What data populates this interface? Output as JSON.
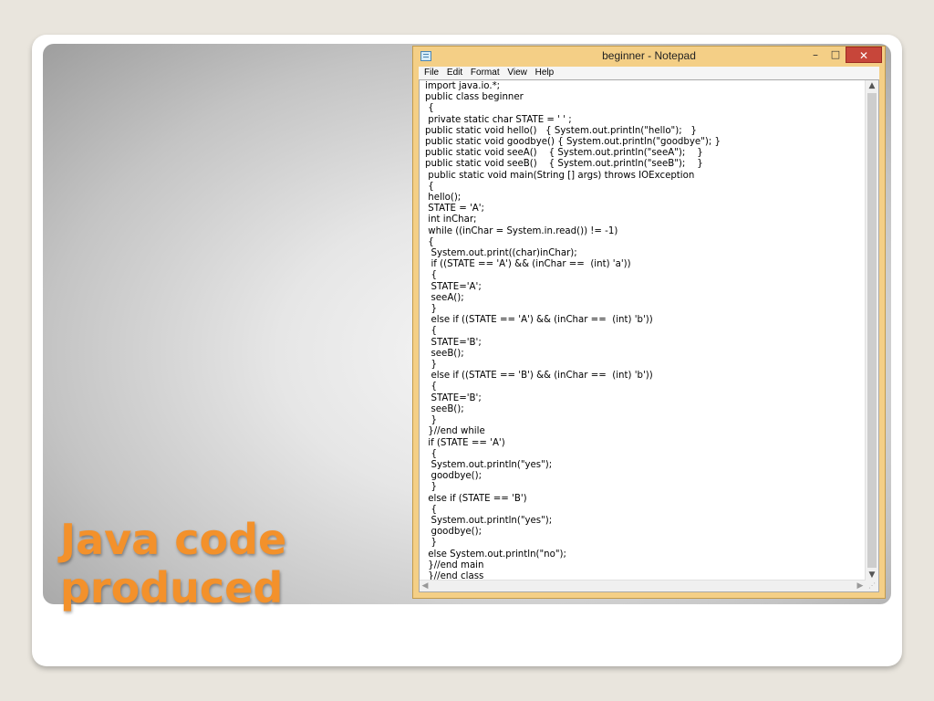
{
  "slide": {
    "title_line1": "Java code",
    "title_line2": "produced"
  },
  "window": {
    "title": "beginner - Notepad",
    "minimize": "–",
    "maximize": "□",
    "close": "✕"
  },
  "menu": {
    "file": "File",
    "edit": "Edit",
    "format": "Format",
    "view": "View",
    "help": "Help"
  },
  "editor": {
    "code": "import java.io.*;\npublic class beginner\n {\n private static char STATE = ' ' ;\npublic static void hello()   { System.out.println(\"hello\");   }\npublic static void goodbye() { System.out.println(\"goodbye\"); }\npublic static void seeA()    { System.out.println(\"seeA\");    }\npublic static void seeB()    { System.out.println(\"seeB\");    }\n public static void main(String [] args) throws IOException\n {\n hello();\n STATE = 'A';\n int inChar;\n while ((inChar = System.in.read()) != -1)\n {\n  System.out.print((char)inChar);\n  if ((STATE == 'A') && (inChar ==  (int) 'a'))\n  {\n  STATE='A';\n  seeA();\n  }\n  else if ((STATE == 'A') && (inChar ==  (int) 'b'))\n  {\n  STATE='B';\n  seeB();\n  }\n  else if ((STATE == 'B') && (inChar ==  (int) 'b'))\n  {\n  STATE='B';\n  seeB();\n  }\n }//end while\n if (STATE == 'A')\n  {\n  System.out.println(\"yes\");\n  goodbye();\n  }\n else if (STATE == 'B')\n  {\n  System.out.println(\"yes\");\n  goodbye();\n  }\n else System.out.println(\"no\");\n }//end main\n }//end class"
  },
  "colors": {
    "title": "#f3912b",
    "window_frame": "#f4cf86",
    "close_button": "#c7463a"
  }
}
